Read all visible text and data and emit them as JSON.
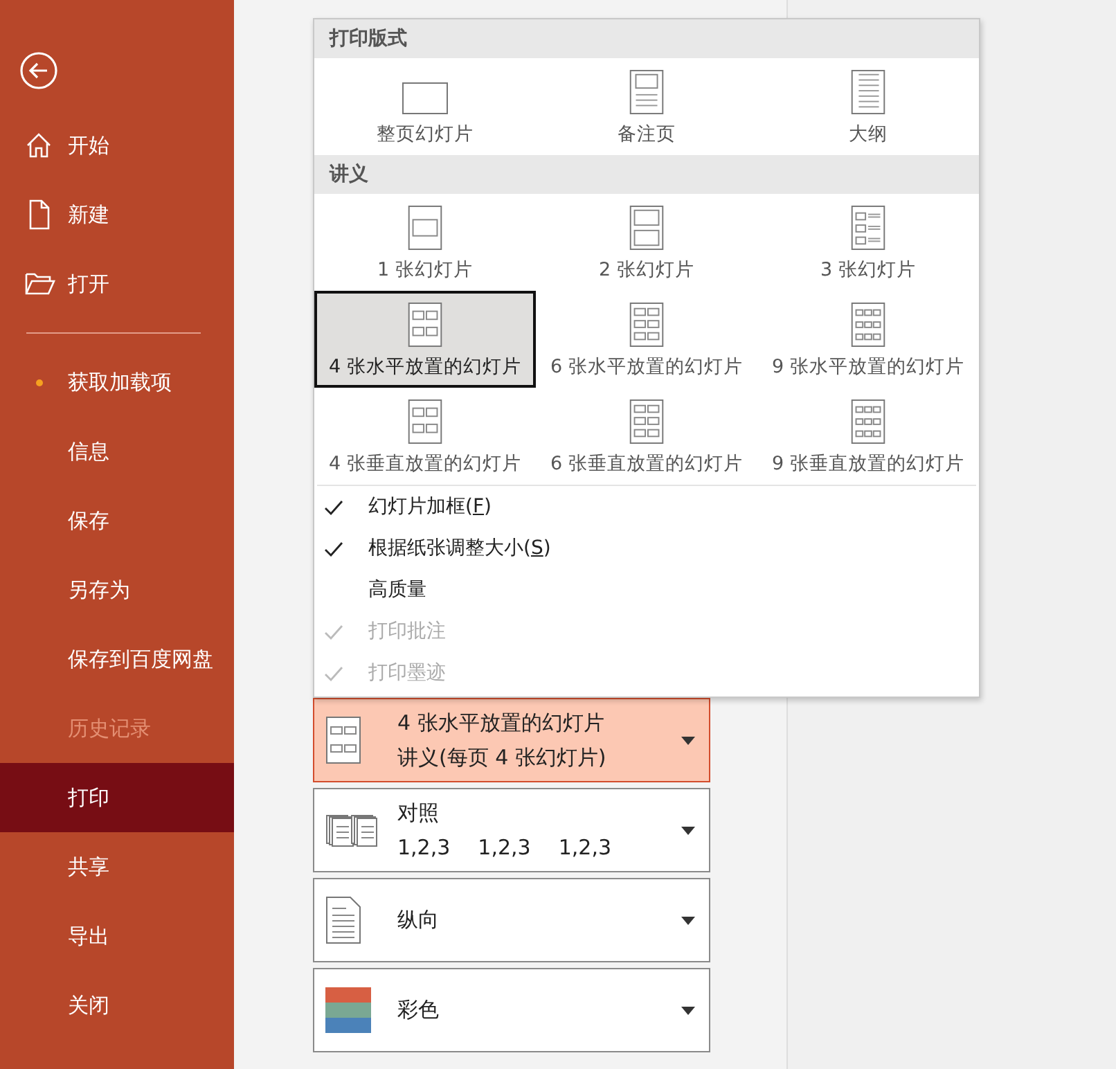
{
  "sidebar": {
    "items": [
      {
        "label": "开始",
        "kind": "home",
        "selected": false,
        "disabled": false,
        "dot": false
      },
      {
        "label": "新建",
        "kind": "new",
        "selected": false,
        "disabled": false,
        "dot": false
      },
      {
        "label": "打开",
        "kind": "open",
        "selected": false,
        "disabled": false,
        "dot": false
      },
      {
        "label": "获取加载项",
        "kind": "plain",
        "selected": false,
        "disabled": false,
        "dot": true,
        "divider_before": true
      },
      {
        "label": "信息",
        "kind": "plain",
        "selected": false,
        "disabled": false,
        "dot": false
      },
      {
        "label": "保存",
        "kind": "plain",
        "selected": false,
        "disabled": false,
        "dot": false
      },
      {
        "label": "另存为",
        "kind": "plain",
        "selected": false,
        "disabled": false,
        "dot": false
      },
      {
        "label": "保存到百度网盘",
        "kind": "plain",
        "selected": false,
        "disabled": false,
        "dot": false
      },
      {
        "label": "历史记录",
        "kind": "plain",
        "selected": false,
        "disabled": true,
        "dot": false
      },
      {
        "label": "打印",
        "kind": "plain",
        "selected": true,
        "disabled": false,
        "dot": false
      },
      {
        "label": "共享",
        "kind": "plain",
        "selected": false,
        "disabled": false,
        "dot": false
      },
      {
        "label": "导出",
        "kind": "plain",
        "selected": false,
        "disabled": false,
        "dot": false
      },
      {
        "label": "关闭",
        "kind": "plain",
        "selected": false,
        "disabled": false,
        "dot": false
      }
    ]
  },
  "layout_menu": {
    "sections": [
      {
        "title": "打印版式",
        "items": [
          {
            "label": "整页幻灯片",
            "kind": "full",
            "selected": false
          },
          {
            "label": "备注页",
            "kind": "notes",
            "selected": false
          },
          {
            "label": "大纲",
            "kind": "outline",
            "selected": false
          }
        ]
      },
      {
        "title": "讲义",
        "items": [
          {
            "label": "1 张幻灯片",
            "kind": "h1",
            "selected": false
          },
          {
            "label": "2 张幻灯片",
            "kind": "h2",
            "selected": false
          },
          {
            "label": "3 张幻灯片",
            "kind": "h3",
            "selected": false
          },
          {
            "label": "4 张水平放置的幻灯片",
            "kind": "g4",
            "selected": true
          },
          {
            "label": "6 张水平放置的幻灯片",
            "kind": "g6",
            "selected": false
          },
          {
            "label": "9 张水平放置的幻灯片",
            "kind": "g9",
            "selected": false
          },
          {
            "label": "4 张垂直放置的幻灯片",
            "kind": "g4",
            "selected": false
          },
          {
            "label": "6 张垂直放置的幻灯片",
            "kind": "g6",
            "selected": false
          },
          {
            "label": "9 张垂直放置的幻灯片",
            "kind": "g9",
            "selected": false
          }
        ]
      }
    ],
    "options": [
      {
        "label": "幻灯片加框(",
        "access_key": "F",
        "label_end": ")",
        "checked": true,
        "disabled": false
      },
      {
        "label": "根据纸张调整大小(",
        "access_key": "S",
        "label_end": ")",
        "checked": true,
        "disabled": false
      },
      {
        "label": "高质量",
        "checked": false,
        "disabled": false
      },
      {
        "label": "打印批注",
        "checked": true,
        "disabled": true
      },
      {
        "label": "打印墨迹",
        "checked": true,
        "disabled": true
      }
    ]
  },
  "settings": [
    {
      "kind": "handout",
      "selected": true,
      "title": "4 张水平放置的幻灯片",
      "subtitle": "讲义(每页 4 张幻灯片)"
    },
    {
      "kind": "collate",
      "selected": false,
      "title": "对照",
      "groups": [
        "1,2,3",
        "1,2,3",
        "1,2,3"
      ]
    },
    {
      "kind": "portrait",
      "selected": false,
      "title": "纵向"
    },
    {
      "kind": "color",
      "selected": false,
      "title": "彩色"
    }
  ]
}
